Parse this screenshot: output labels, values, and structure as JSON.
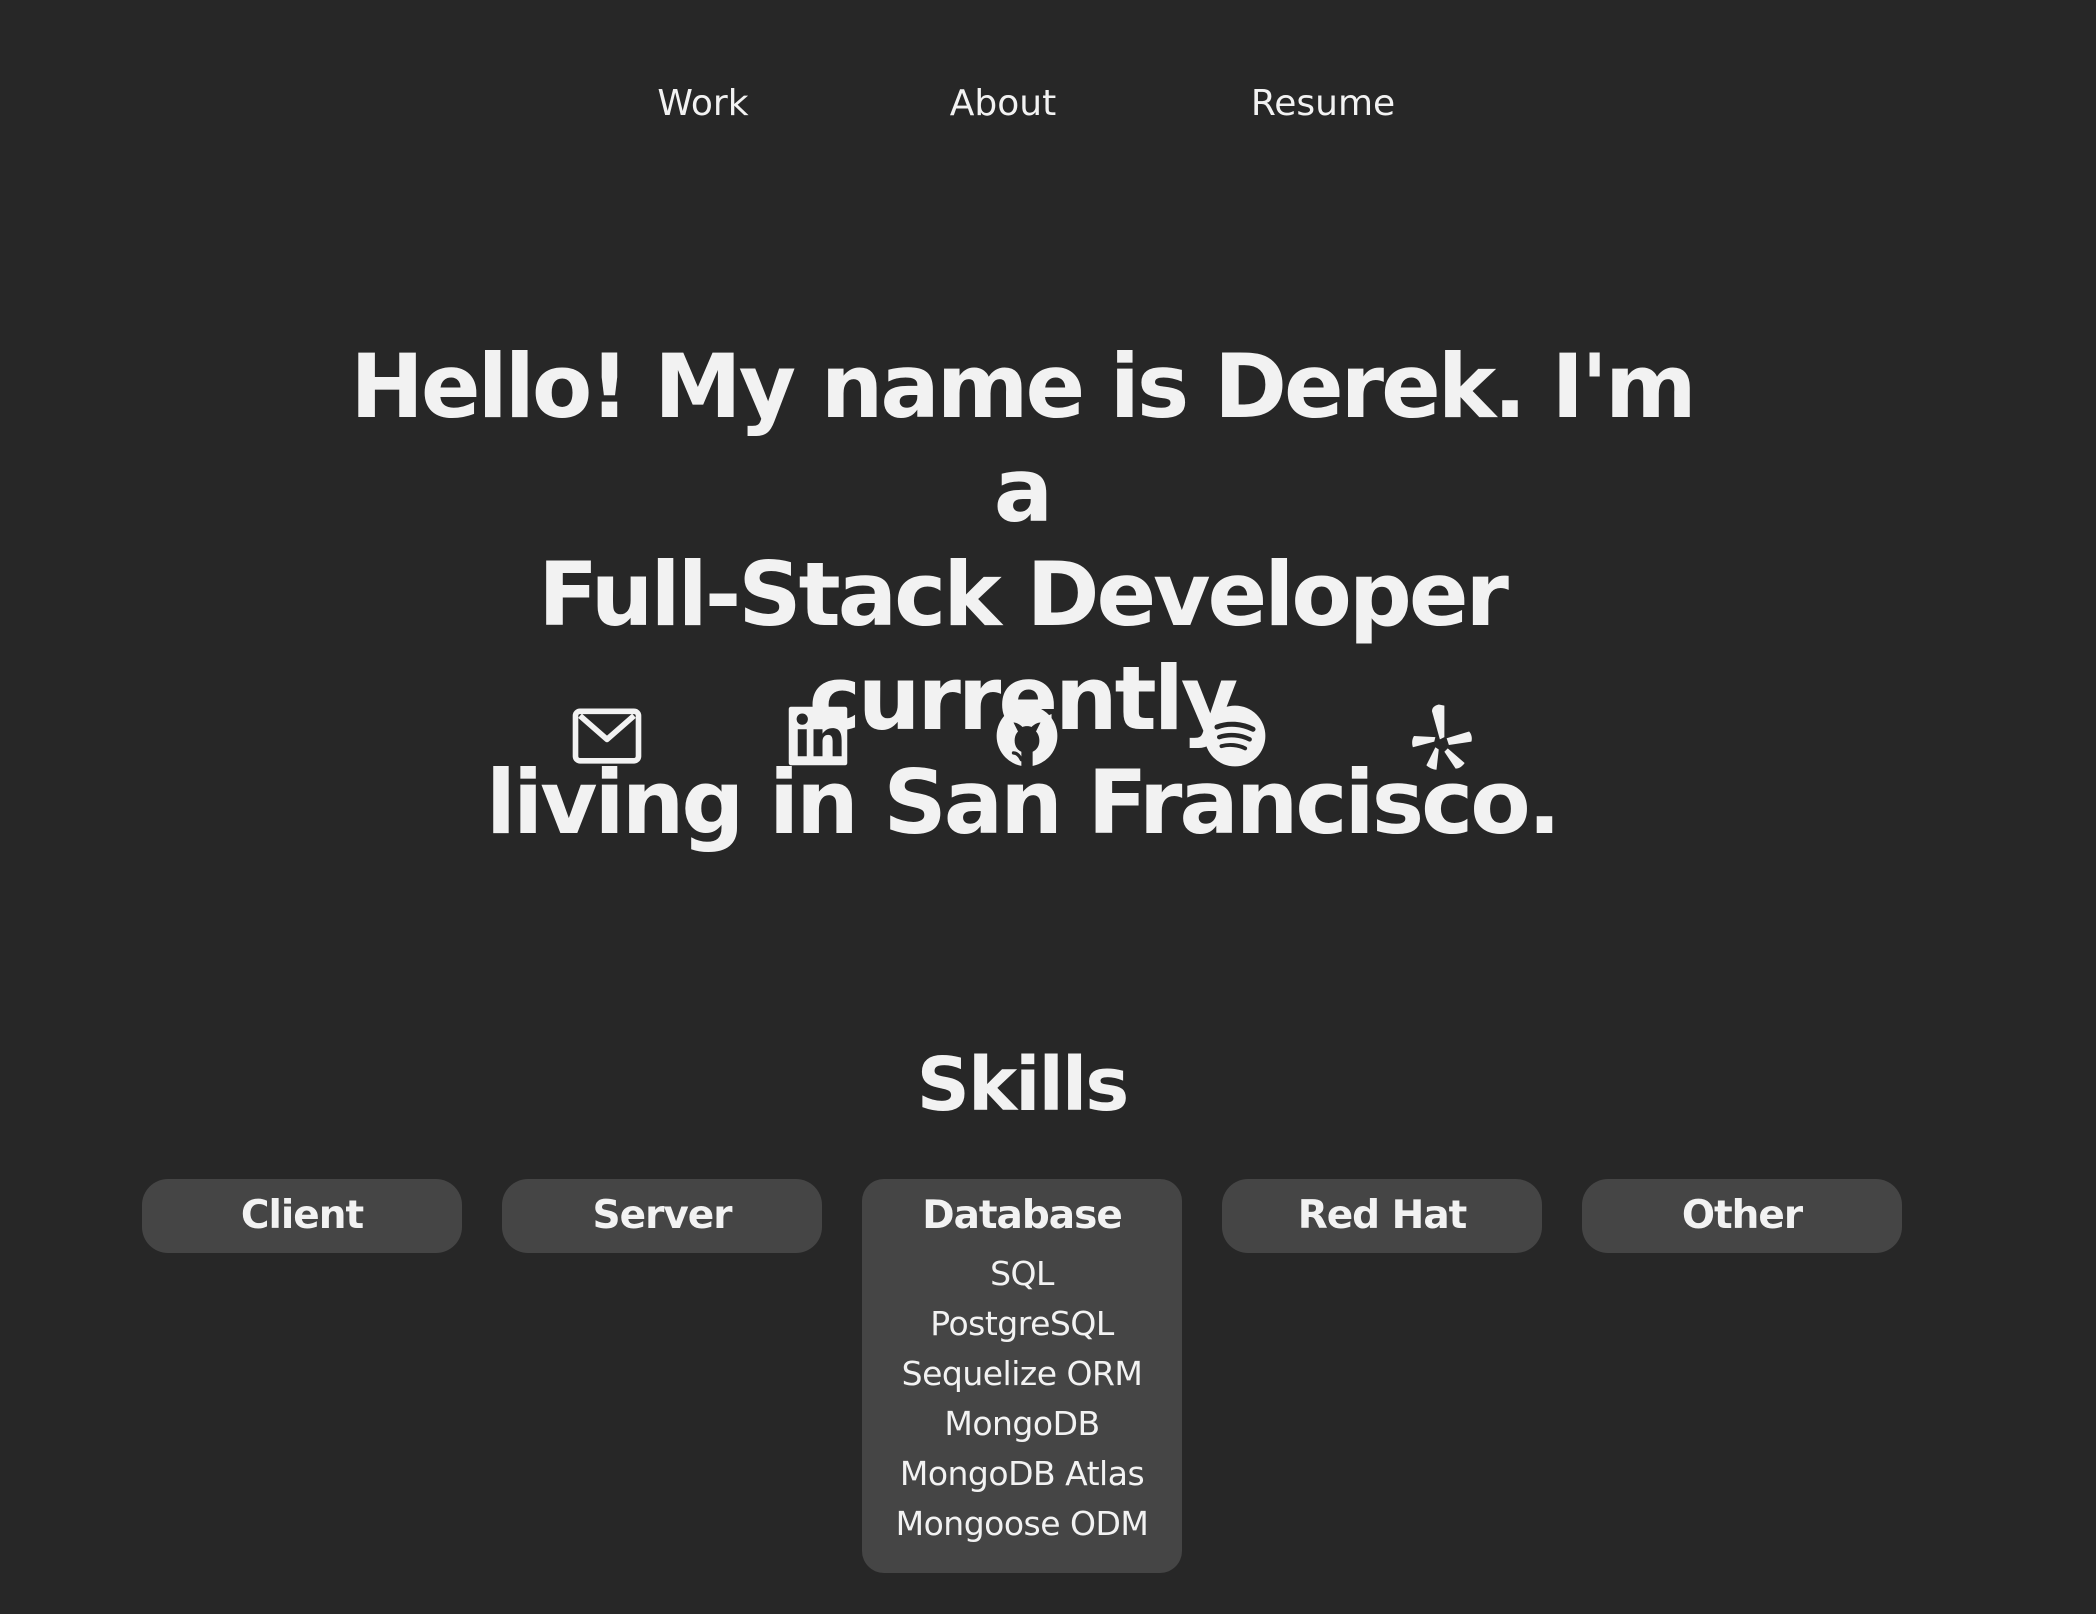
{
  "nav": {
    "work": "Work",
    "about": "About",
    "resume": "Resume"
  },
  "hero": {
    "line1": "Hello! My name is Derek. I'm a",
    "line2": "Full-Stack Developer currently",
    "line3": "living in San Francisco."
  },
  "socials": [
    {
      "name": "email",
      "icon": "mail-icon"
    },
    {
      "name": "linkedin",
      "icon": "linkedin-icon"
    },
    {
      "name": "github",
      "icon": "github-icon"
    },
    {
      "name": "spotify",
      "icon": "spotify-icon"
    },
    {
      "name": "yelp",
      "icon": "yelp-icon"
    }
  ],
  "skills": {
    "title": "Skills",
    "tabs": [
      {
        "label": "Client"
      },
      {
        "label": "Server"
      },
      {
        "label": "Database",
        "expanded": true,
        "items": [
          "SQL",
          "PostgreSQL",
          "Sequelize ORM",
          "MongoDB",
          "MongoDB Atlas",
          "Mongoose ODM"
        ]
      },
      {
        "label": "Red Hat"
      },
      {
        "label": "Other"
      }
    ]
  },
  "colors": {
    "background": "#272727",
    "text": "#f2f2f2",
    "tab_background": "#454545"
  }
}
